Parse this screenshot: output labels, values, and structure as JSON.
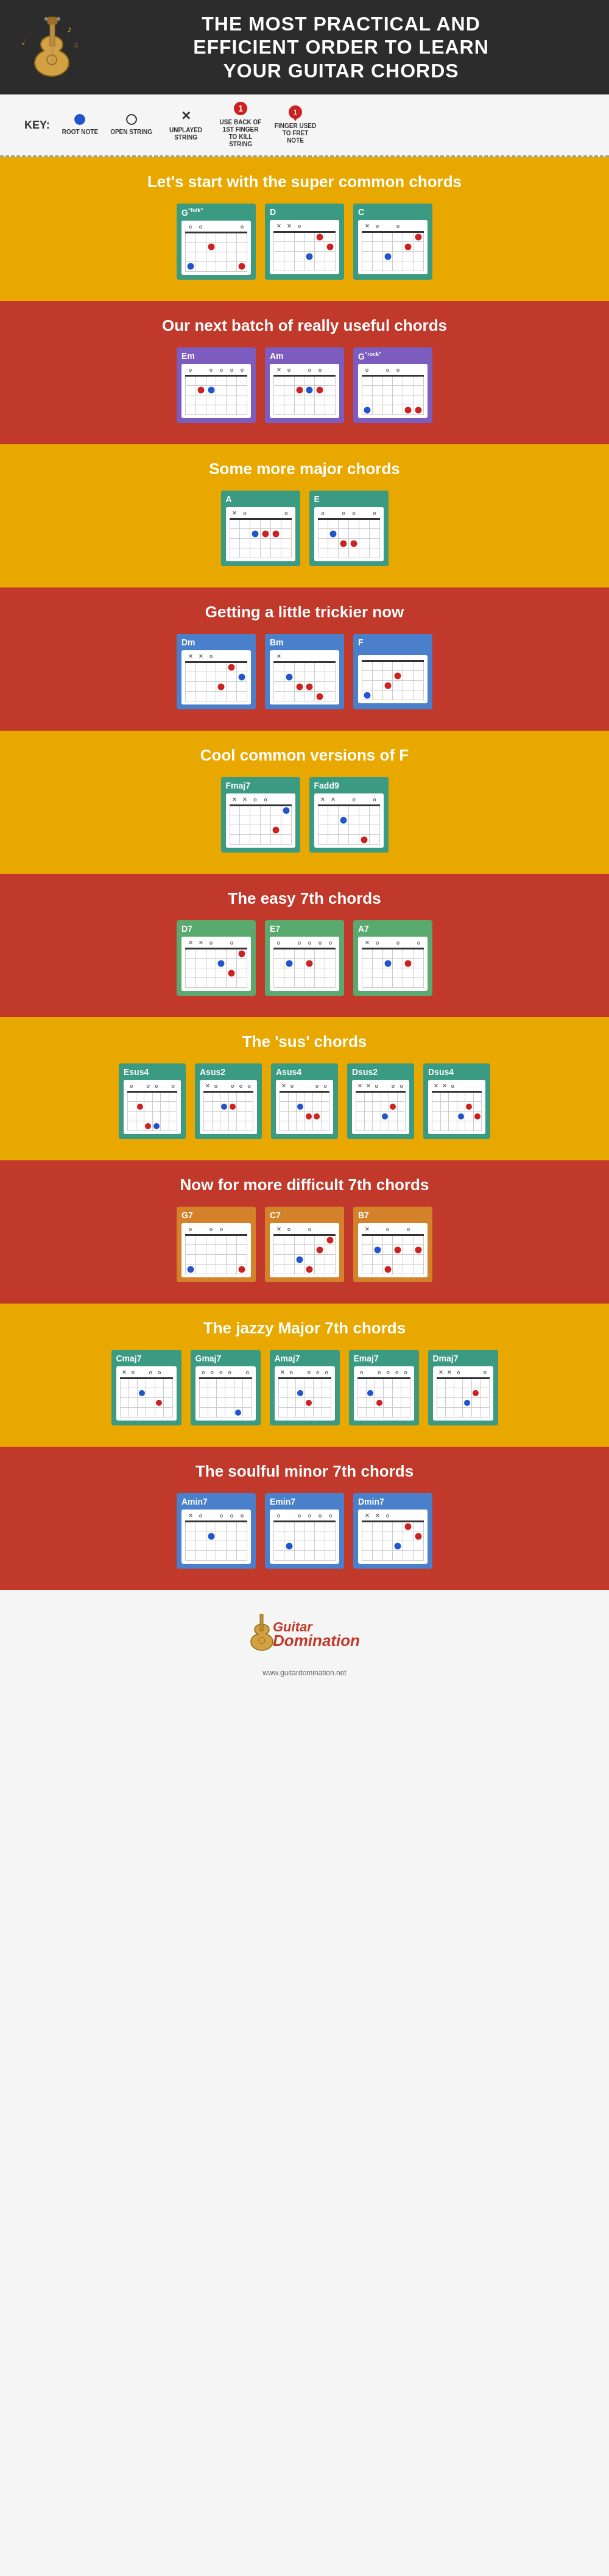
{
  "header": {
    "title_line1": "THE MOST PRACTICAL AND",
    "title_line2": "EFFICIENT ORDER TO LEARN",
    "title_line3": "YOUR GUITAR CHORDS"
  },
  "key": {
    "label": "KEY:",
    "items": [
      {
        "symbol": "dot-blue",
        "text": "ROOT NOTE"
      },
      {
        "symbol": "dot-open",
        "text": "OPEN STRING"
      },
      {
        "symbol": "X",
        "text": "UNPLAYED STRING"
      },
      {
        "symbol": "finger-kill",
        "text": "USE BACK OF 1ST FINGER TO KILL STRING"
      },
      {
        "symbol": "fret-note",
        "text": "FINGER USED TO FRET NOTE"
      }
    ]
  },
  "sections": [
    {
      "id": "super-common",
      "bg": "yellow",
      "title": "Let's start with the super common chords",
      "chords": [
        "G\"folk\"",
        "D",
        "C"
      ]
    },
    {
      "id": "really-useful",
      "bg": "red",
      "title": "Our next batch of really useful chords",
      "chords": [
        "Em",
        "Am",
        "G\"rock\""
      ]
    },
    {
      "id": "more-major",
      "bg": "yellow",
      "title": "Some more major chords",
      "chords": [
        "A",
        "E"
      ]
    },
    {
      "id": "trickier",
      "bg": "red",
      "title": "Getting a little trickier now",
      "chords": [
        "Dm",
        "Bm",
        "F"
      ]
    },
    {
      "id": "cool-f",
      "bg": "yellow",
      "title": "Cool common versions of F",
      "chords": [
        "Fmaj7",
        "Fadd9"
      ]
    },
    {
      "id": "easy-7th",
      "bg": "red",
      "title": "The easy 7th chords",
      "chords": [
        "D7",
        "E7",
        "A7"
      ]
    },
    {
      "id": "sus-chords",
      "bg": "yellow",
      "title": "The 'sus' chords",
      "chords": [
        "Esus4",
        "Asus2",
        "Asus4",
        "Dsus2",
        "Dsus4"
      ]
    },
    {
      "id": "difficult-7th",
      "bg": "red",
      "title": "Now for more difficult 7th chords",
      "chords": [
        "G7",
        "C7",
        "B7"
      ]
    },
    {
      "id": "jazzy-maj7",
      "bg": "yellow",
      "title": "The jazzy Major 7th chords",
      "chords": [
        "Cmaj7",
        "Gmaj7",
        "Amaj7",
        "Emaj7",
        "Dmaj7"
      ]
    },
    {
      "id": "soulful-min7",
      "bg": "red",
      "title": "The soulful minor 7th chords",
      "chords": [
        "Amin7",
        "Emin7",
        "Dmin7"
      ]
    }
  ],
  "footer": {
    "logo_top": "Guitar",
    "logo_bottom": "Domination",
    "website": "www.guitardomination.net"
  }
}
